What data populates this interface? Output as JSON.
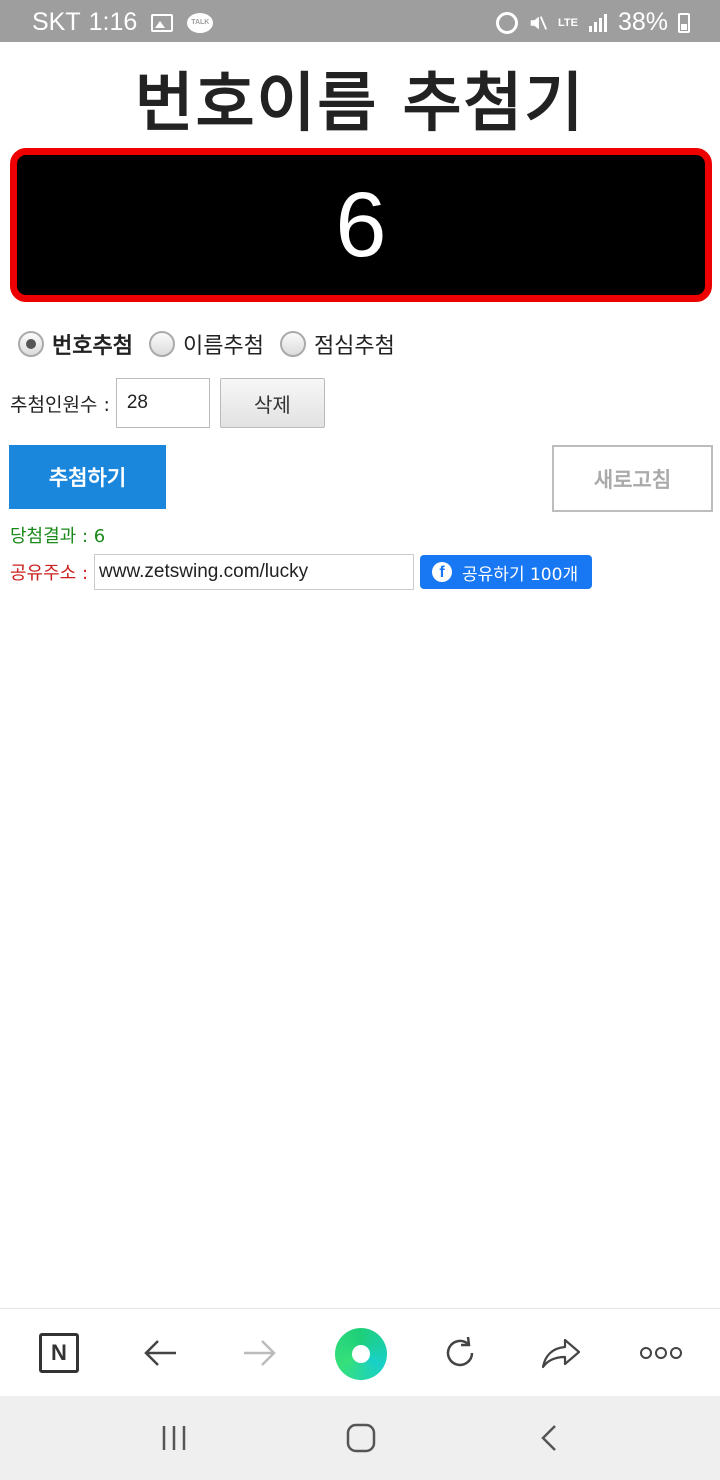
{
  "status_bar": {
    "carrier": "SKT",
    "time": "1:16",
    "talk_badge": "TALK",
    "network": "LTE",
    "battery": "38%",
    "icons": [
      "image-icon",
      "talk-icon",
      "alarm-icon",
      "mute-icon",
      "lte-icon",
      "signal-icon",
      "battery-icon"
    ]
  },
  "header": {
    "title": "번호이름 추첨기"
  },
  "display": {
    "value": "6",
    "background": "#000000",
    "border_color": "#ee0000"
  },
  "modes": [
    {
      "label": "번호추첨",
      "checked": true
    },
    {
      "label": "이름추첨",
      "checked": false
    },
    {
      "label": "점심추첨",
      "checked": false
    }
  ],
  "count": {
    "label": "추첨인원수 :",
    "value": "28",
    "delete_label": "삭제"
  },
  "actions": {
    "draw_label": "추첨하기",
    "refresh_label": "새로고침",
    "draw_color": "#1a86dc"
  },
  "result": {
    "text": "당첨결과 : 6"
  },
  "share": {
    "label": "공유주소 :",
    "url": "www.zetswing.com/lucky",
    "fb_label": "공유하기 100개",
    "fb_color": "#1877f2"
  },
  "browser_toolbar": {
    "naver_label": "N",
    "icons": [
      "naver-icon",
      "back-arrow-icon",
      "forward-arrow-icon",
      "green-dot-home-icon",
      "reload-icon",
      "share-icon",
      "more-icon"
    ]
  },
  "android_nav": {
    "icons": [
      "recent-apps-icon",
      "home-icon",
      "back-icon"
    ]
  }
}
